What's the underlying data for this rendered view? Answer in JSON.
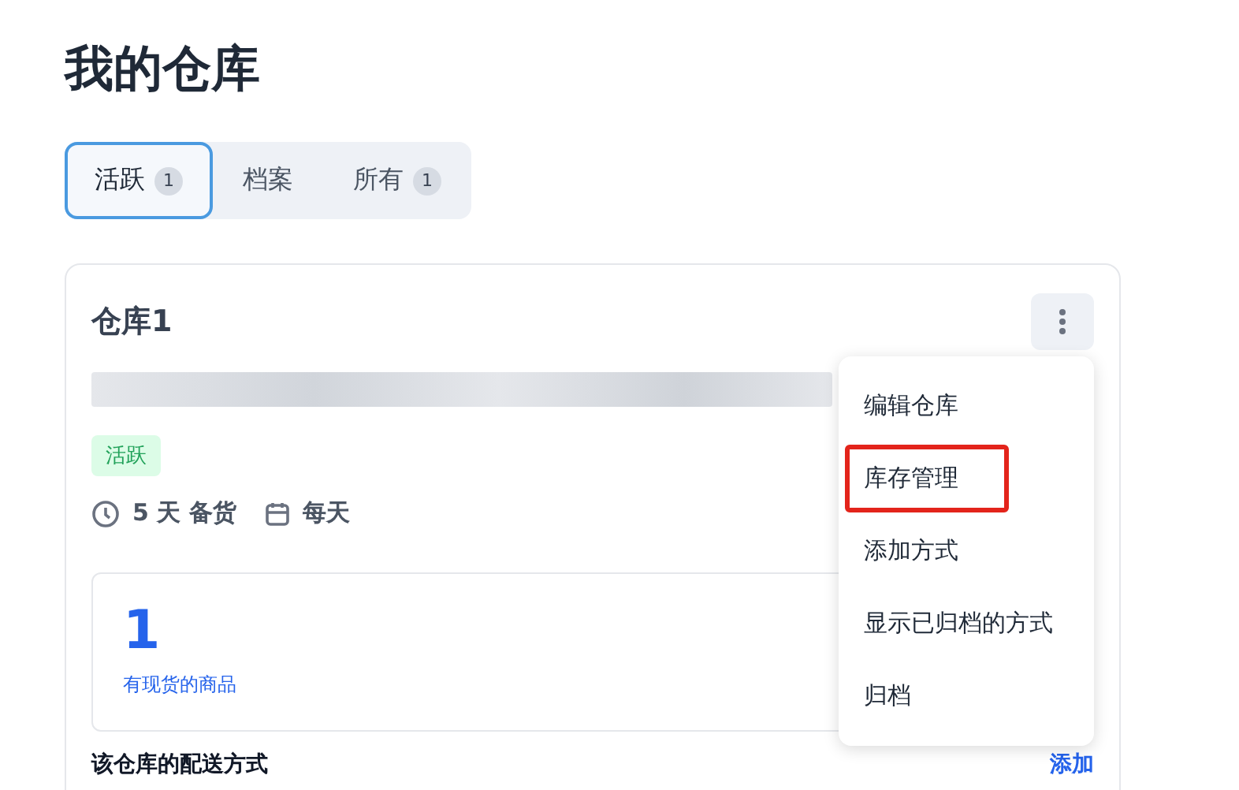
{
  "page_title": "我的仓库",
  "tabs": [
    {
      "label": "活跃",
      "count": "1",
      "selected": true
    },
    {
      "label": "档案",
      "selected": false
    },
    {
      "label": "所有",
      "count": "1",
      "selected": false
    }
  ],
  "warehouse": {
    "name": "仓库1",
    "address_redacted": true,
    "status": "活跃",
    "lead_time": "5 天 备货",
    "schedule": "每天",
    "stats": {
      "value": "1",
      "label": "有现货的商品"
    },
    "section_heading": "该仓库的配送方式",
    "section_action": "添加"
  },
  "menu": {
    "open": true,
    "items": [
      {
        "label": "编辑仓库",
        "highlighted": false
      },
      {
        "label": "库存管理",
        "highlighted": true
      },
      {
        "label": "添加方式",
        "highlighted": false
      },
      {
        "label": "显示已归档的方式",
        "highlighted": false
      },
      {
        "label": "归档",
        "highlighted": false
      }
    ]
  }
}
